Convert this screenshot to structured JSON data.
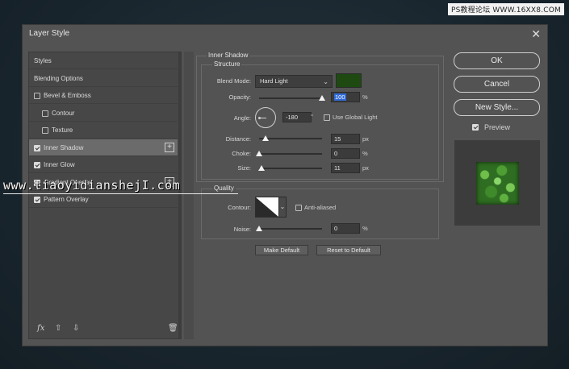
{
  "watermark_top": "PS教程论坛 WWW.16XX8.COM",
  "watermark_mid": "www.tiaoyidianshejI.com",
  "dialog": {
    "title": "Layer Style",
    "close_icon": "close-icon"
  },
  "sidebar": {
    "items": [
      {
        "label": "Styles",
        "checkbox": null,
        "selected": false,
        "plus": false
      },
      {
        "label": "Blending Options",
        "checkbox": null,
        "selected": false,
        "plus": false
      },
      {
        "label": "Bevel & Emboss",
        "checkbox": false,
        "selected": false,
        "plus": false
      },
      {
        "label": "Contour",
        "checkbox": false,
        "selected": false,
        "plus": false
      },
      {
        "label": "Texture",
        "checkbox": false,
        "selected": false,
        "plus": false
      },
      {
        "label": "Inner Shadow",
        "checkbox": true,
        "selected": true,
        "plus": true
      },
      {
        "label": "Inner Glow",
        "checkbox": true,
        "selected": false,
        "plus": false
      },
      {
        "label": "Gradient Overlay",
        "checkbox": true,
        "selected": false,
        "plus": true
      },
      {
        "label": "Pattern Overlay",
        "checkbox": true,
        "selected": false,
        "plus": false
      }
    ],
    "footer_icons": [
      "fx-icon",
      "arrow-up-icon",
      "arrow-down-icon",
      "trash-icon"
    ],
    "fx_label": "fx"
  },
  "inner_shadow": {
    "title": "Inner Shadow",
    "structure_title": "Structure",
    "blend_mode_label": "Blend Mode:",
    "blend_mode_value": "Hard Light",
    "color": "#1e4a12",
    "opacity_label": "Opacity:",
    "opacity_value": "100",
    "opacity_level": 1.0,
    "opacity_unit": "%",
    "angle_label": "Angle:",
    "angle_value": "-180",
    "angle_unit": "°",
    "use_global_light_label": "Use Global Light",
    "use_global_light": false,
    "distance_label": "Distance:",
    "distance_value": "15",
    "distance_level": 0.1,
    "distance_unit": "px",
    "choke_label": "Choke:",
    "choke_value": "0",
    "choke_level": 0.0,
    "choke_unit": "%",
    "size_label": "Size:",
    "size_value": "11",
    "size_level": 0.04,
    "size_unit": "px"
  },
  "quality": {
    "title": "Quality",
    "contour_label": "Contour:",
    "anti_aliased_label": "Anti-aliased",
    "anti_aliased": false,
    "noise_label": "Noise:",
    "noise_value": "0",
    "noise_level": 0.0,
    "noise_unit": "%"
  },
  "buttons": {
    "make_default": "Make Default",
    "reset_to_default": "Reset to Default",
    "ok": "OK",
    "cancel": "Cancel",
    "new_style": "New Style...",
    "preview_label": "Preview",
    "preview_checked": true
  }
}
